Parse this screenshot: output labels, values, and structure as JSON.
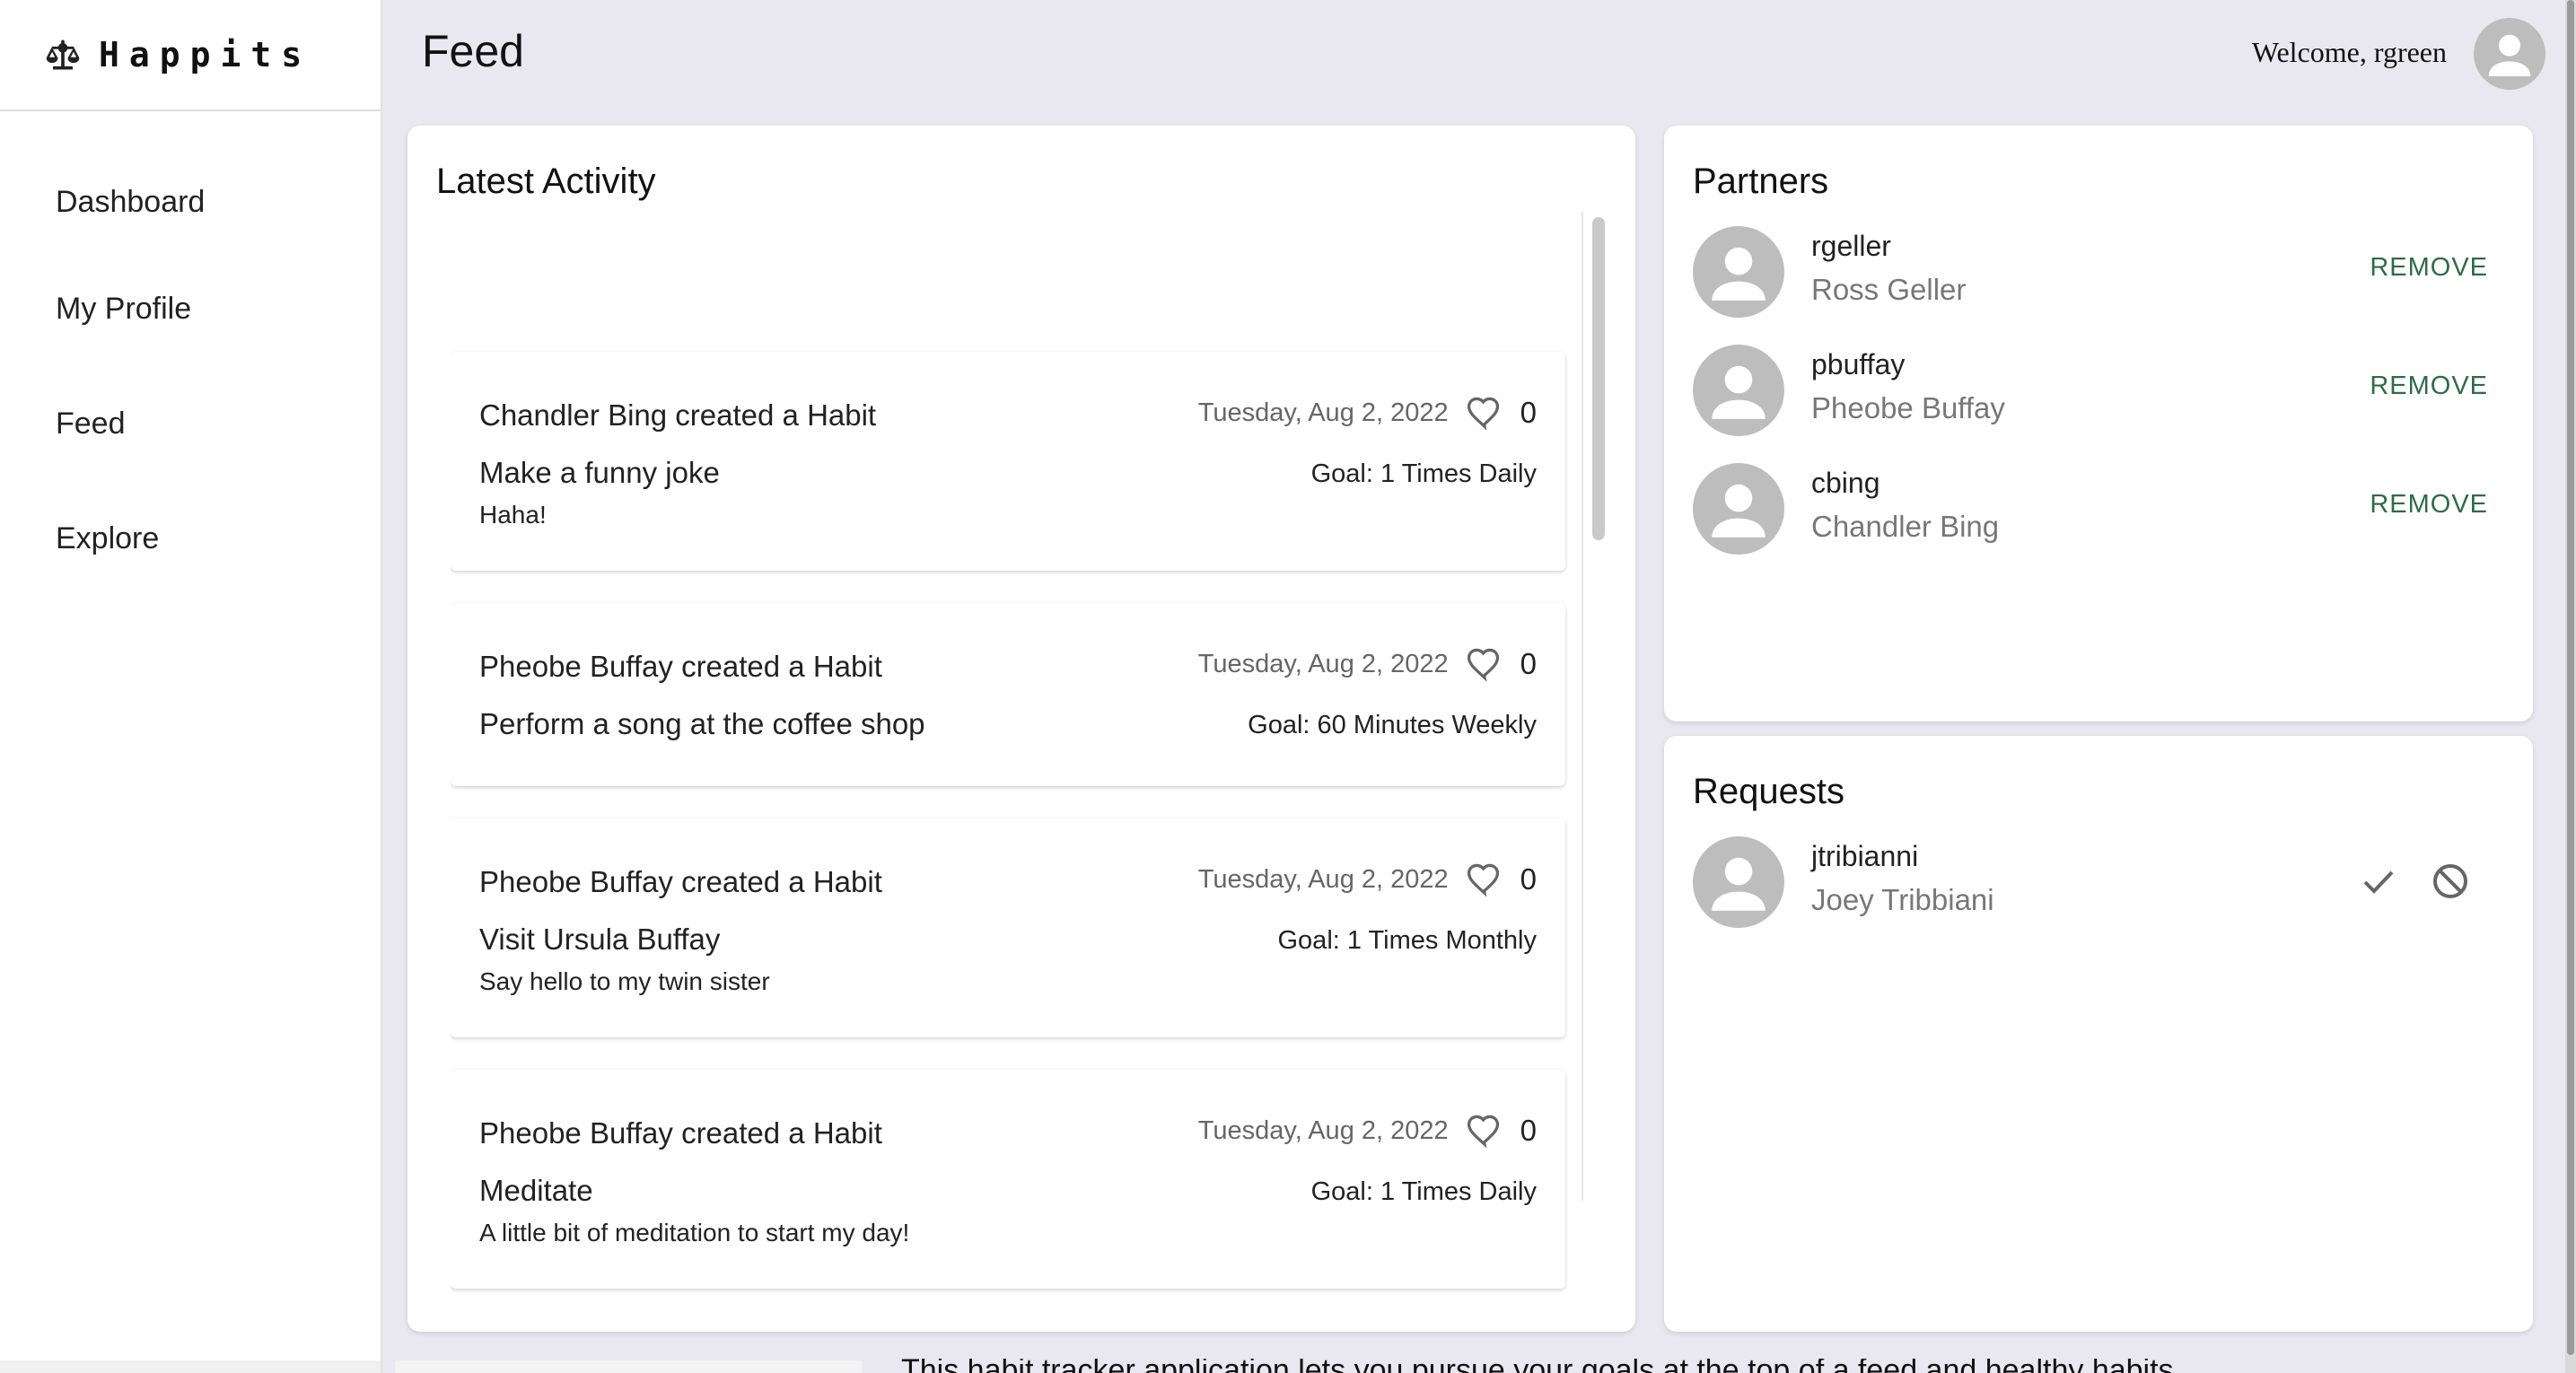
{
  "app": {
    "brand": "Happits",
    "page_title": "Feed",
    "welcome": "Welcome, rgreen"
  },
  "sidebar": {
    "items": [
      {
        "label": "Dashboard"
      },
      {
        "label": "My Profile"
      },
      {
        "label": "Feed"
      },
      {
        "label": "Explore"
      }
    ]
  },
  "activity": {
    "title": "Latest Activity",
    "items": [
      {
        "headline": "Chandler Bing created a Habit",
        "date": "Tuesday, Aug 2, 2022",
        "likes": "0",
        "habit": "Make a funny joke",
        "goal": "Goal: 1 Times Daily",
        "description": "Haha!"
      },
      {
        "headline": "Pheobe Buffay created a Habit",
        "date": "Tuesday, Aug 2, 2022",
        "likes": "0",
        "habit": "Perform a song at the coffee shop",
        "goal": "Goal: 60 Minutes Weekly",
        "description": ""
      },
      {
        "headline": "Pheobe Buffay created a Habit",
        "date": "Tuesday, Aug 2, 2022",
        "likes": "0",
        "habit": "Visit Ursula Buffay",
        "goal": "Goal: 1 Times Monthly",
        "description": "Say hello to my twin sister"
      },
      {
        "headline": "Pheobe Buffay created a Habit",
        "date": "Tuesday, Aug 2, 2022",
        "likes": "0",
        "habit": "Meditate",
        "goal": "Goal: 1 Times Daily",
        "description": "A little bit of meditation to start my day!"
      }
    ]
  },
  "partners": {
    "title": "Partners",
    "remove_label": "REMOVE",
    "items": [
      {
        "username": "rgeller",
        "name": "Ross Geller"
      },
      {
        "username": "pbuffay",
        "name": "Pheobe Buffay"
      },
      {
        "username": "cbing",
        "name": "Chandler Bing"
      }
    ]
  },
  "requests": {
    "title": "Requests",
    "items": [
      {
        "username": "jtribianni",
        "name": "Joey Tribbiani"
      }
    ]
  },
  "footer": {
    "partial_text": "This habit tracker application lets you pursue your goals at the top of a feed and healthy habits"
  }
}
